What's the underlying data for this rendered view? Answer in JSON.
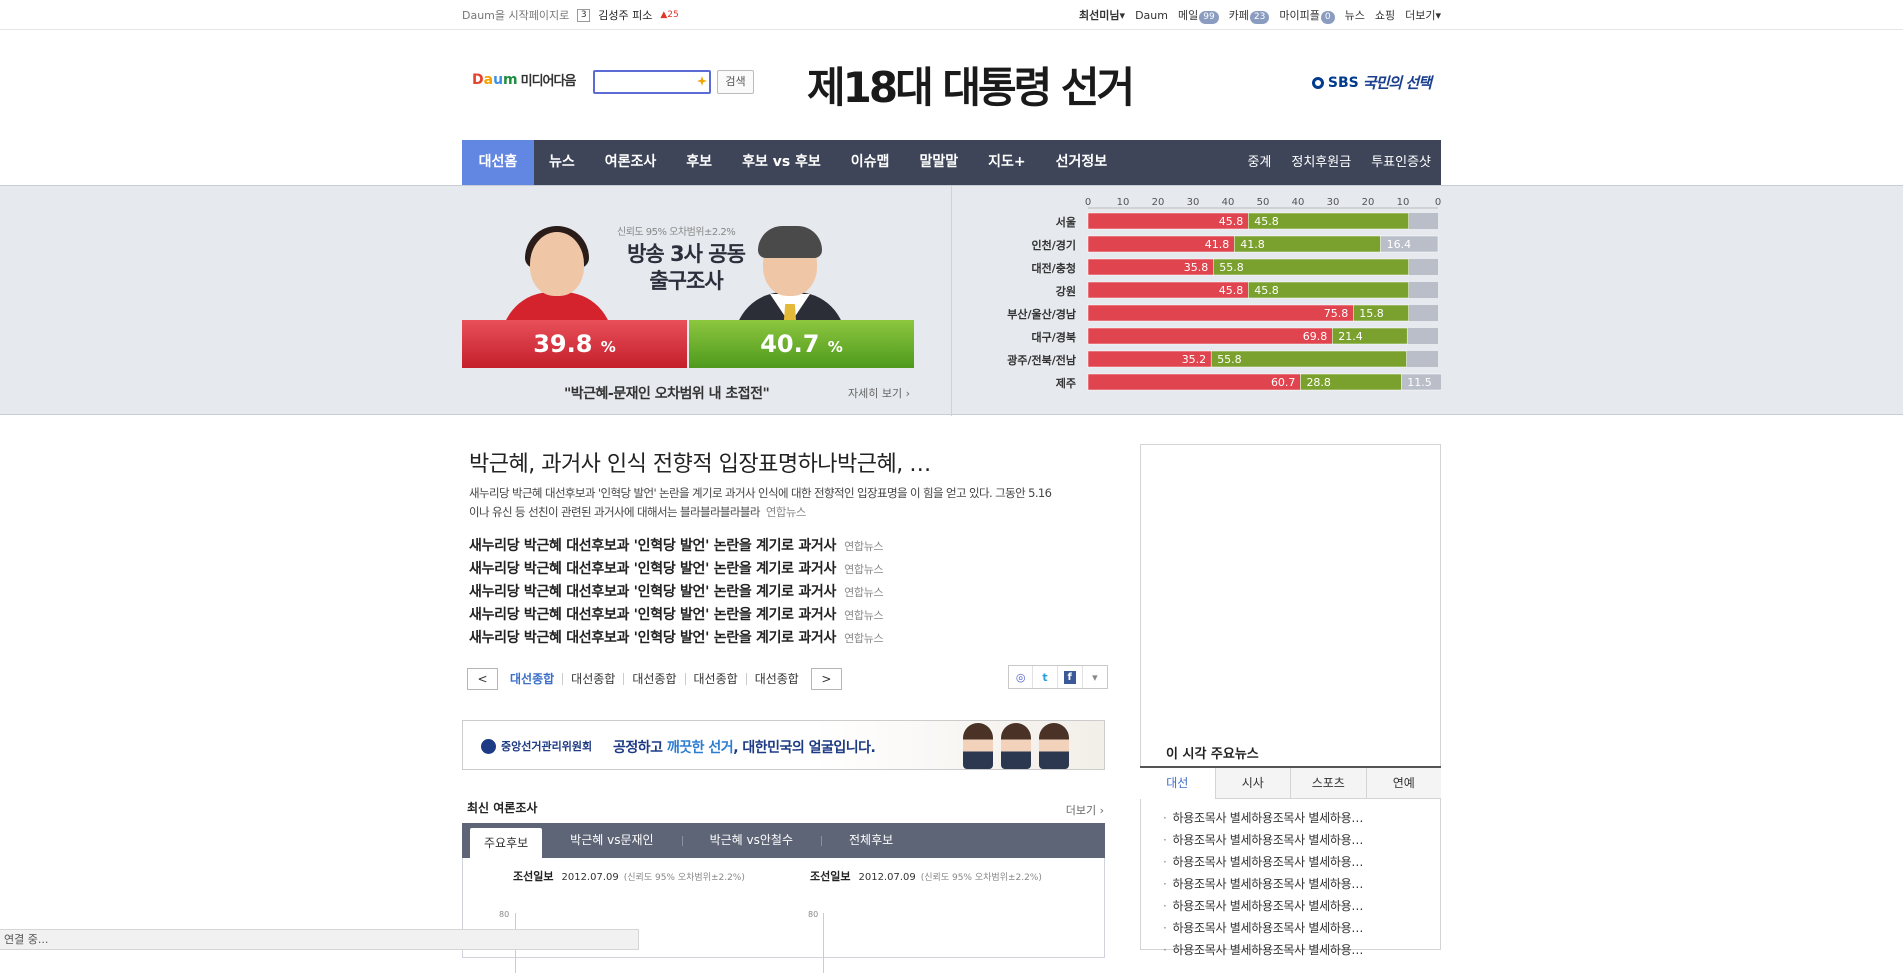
{
  "topbar": {
    "start_page": "Daum을 시작페이지로",
    "rank": "3",
    "keyword": "김성주 피소",
    "rank_change": "25",
    "links": [
      {
        "label": "최선미님",
        "caret": "▾",
        "bold": true
      },
      {
        "label": "Daum"
      },
      {
        "label": "메일",
        "count": "99"
      },
      {
        "label": "카페",
        "count": "23"
      },
      {
        "label": "마이피플",
        "count": "0"
      },
      {
        "label": "뉴스"
      },
      {
        "label": "쇼핑"
      },
      {
        "label": "더보기",
        "caret": "▾"
      }
    ]
  },
  "header": {
    "logo_d": "D",
    "logo_a": "a",
    "logo_u": "u",
    "logo_m": "m",
    "logo_media": "미디어다음",
    "search_button": "검색",
    "title": "제18대 대통령 선거",
    "sbs_brand": "SBS",
    "sbs_slogan": "국민의 선택"
  },
  "nav": {
    "items": [
      "대선홈",
      "뉴스",
      "여론조사",
      "후보",
      "후보 vs 후보",
      "이슈맵",
      "말말말",
      "지도+",
      "선거정보"
    ],
    "right_items": [
      "중계",
      "정치후원금",
      "투표인증샷"
    ]
  },
  "exit_poll": {
    "note": "신뢰도 95% 오차범위±2.2%",
    "title_line1": "방송 3사 공동",
    "title_line2": "출구조사",
    "park_value": "39.8",
    "moon_value": "40.7",
    "percent_sign": "%",
    "quote": "\"박근혜-문재인 오차범위 내 초접전\"",
    "more": "자세히 보기 ›"
  },
  "chart_data": {
    "type": "bar",
    "title": "",
    "xlabel": "",
    "ylabel": "",
    "axis_ticks": [
      "0",
      "10",
      "20",
      "30",
      "40",
      "50",
      "40",
      "30",
      "20",
      "10",
      "0"
    ],
    "categories": [
      "서울",
      "인천/경기",
      "대전/충청",
      "강원",
      "부산/울산/경남",
      "대구/경북",
      "광주/전북/전남",
      "제주"
    ],
    "series": [
      {
        "values": [
          45.8,
          41.8,
          35.8,
          45.8,
          75.8,
          69.8,
          35.2,
          60.7
        ],
        "color": "#e0444f"
      },
      {
        "values": [
          45.8,
          41.8,
          55.8,
          45.8,
          15.8,
          21.4,
          55.8,
          28.8
        ],
        "color": "#7aa02e"
      },
      {
        "values": [
          null,
          16.4,
          null,
          null,
          null,
          null,
          null,
          11.5
        ],
        "color": "#b9bec8"
      }
    ]
  },
  "headline": {
    "title": "박근혜, 과거사 인식 전향적 입장표명하나박근혜, …",
    "lead": "새누리당 박근혜 대선후보과 '인혁당 발언' 논란을 계기로 과거사 인식에 대한 전향적인 입장표명을 이 힘을 얻고 있다. 그동안 5.16이나 유신 등 선친이 관련된 과거사에 대해서는 블라블라블라블라",
    "lead_source": "연합뉴스",
    "list": [
      {
        "text": "새누리당 박근혜 대선후보과 '인혁당 발언' 논란을 계기로 과거사",
        "source": "연합뉴스"
      },
      {
        "text": "새누리당 박근혜 대선후보과 '인혁당 발언' 논란을 계기로 과거사",
        "source": "연합뉴스"
      },
      {
        "text": "새누리당 박근혜 대선후보과 '인혁당 발언' 논란을 계기로 과거사",
        "source": "연합뉴스"
      },
      {
        "text": "새누리당 박근혜 대선후보과 '인혁당 발언' 논란을 계기로 과거사",
        "source": "연합뉴스"
      },
      {
        "text": "새누리당 박근혜 대선후보과 '인혁당 발언' 논란을 계기로 과거사",
        "source": "연합뉴스"
      }
    ],
    "pager": [
      "대선종합",
      "대선종합",
      "대선종합",
      "대선종합",
      "대선종합"
    ],
    "prev": "<",
    "next": ">"
  },
  "share": {
    "talk": "◎",
    "twitter": "t",
    "facebook": "f",
    "more": "▾"
  },
  "banner": {
    "org": "중앙선거관리위원회",
    "msg_pre": "공정하고 ",
    "msg_hl": "깨끗한 선거",
    "msg_post": ", 대한민국의 얼굴입니다."
  },
  "polls": {
    "heading": "최신 여론조사",
    "more": "더보기 ›",
    "tabs": [
      "주요후보",
      "박근혜 vs문재인",
      "박근혜 vs안철수",
      "전체후보"
    ],
    "cards": [
      {
        "source": "조선일보",
        "date": "2012.07.09",
        "note": "(신뢰도 95% 오차범위±2.2%)",
        "tick": "80"
      },
      {
        "source": "조선일보",
        "date": "2012.07.09",
        "note": "(신뢰도 95% 오차범위±2.2%)",
        "tick": "80"
      }
    ]
  },
  "right_news": {
    "heading": "이 시각 주요뉴스",
    "tabs": [
      "대선",
      "시사",
      "스포츠",
      "연예"
    ],
    "items": [
      "하용조목사 별세하용조목사 별세하용…",
      "하용조목사 별세하용조목사 별세하용…",
      "하용조목사 별세하용조목사 별세하용…",
      "하용조목사 별세하용조목사 별세하용…",
      "하용조목사 별세하용조목사 별세하용…",
      "하용조목사 별세하용조목사 별세하용…",
      "하용조목사 별세하용조목사 별세하용…"
    ]
  },
  "status": "연결 중..."
}
